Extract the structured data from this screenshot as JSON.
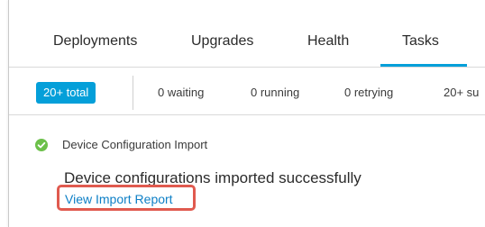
{
  "tabs": [
    {
      "label": "Deployments",
      "active": false
    },
    {
      "label": "Upgrades",
      "active": false
    },
    {
      "label": "Health",
      "active": false
    },
    {
      "label": "Tasks",
      "active": true
    }
  ],
  "filters": {
    "total": "20+ total",
    "items": [
      "0 waiting",
      "0 running",
      "0 retrying",
      "20+ su"
    ]
  },
  "task": {
    "status_icon": "check-circle-icon",
    "title": "Device Configuration Import",
    "message": "Device configurations imported successfully",
    "link": "View Import Report"
  },
  "colors": {
    "accent": "#049fd9",
    "success": "#6cc04a",
    "link": "#0d7fc6",
    "highlight": "#e05a4f"
  }
}
